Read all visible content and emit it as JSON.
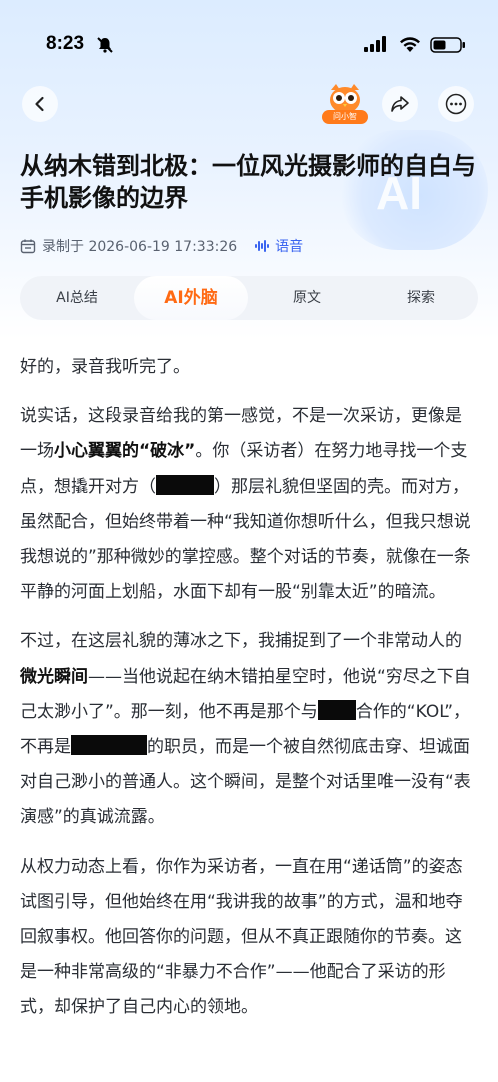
{
  "status_bar": {
    "time": "8:23"
  },
  "header": {
    "mascot_label": "问小智",
    "title": "从纳木错到北极：一位风光摄影师的自白与手机影像的边界",
    "recorded_label": "录制于 2026-06-19 17:33:26",
    "type_label": "语音"
  },
  "deco": {
    "ai_text": "AI"
  },
  "tabs": [
    {
      "label": "AI总结"
    },
    {
      "label": "AI外脑"
    },
    {
      "label": "原文"
    },
    {
      "label": "探索"
    }
  ],
  "content": {
    "p1": "好的，录音我听完了。",
    "p2_a": "说实话，这段录音给我的第一感觉，不是一次采访，更像是一场",
    "p2_b": "小心翼翼的“破冰”",
    "p2_c": "。你（采访者）在努力地寻找一个支点，想撬开对方（",
    "p2_d": "）那层礼貌但坚固的壳。而对方，虽然配合，但始终带着一种“我知道你想听什么，但我只想说我想说的”那种微妙的掌控感。整个对话的节奏，就像在一条平静的河面上划船，水面下却有一股“别靠太近”的暗流。",
    "p3_a": "不过，在这层礼貌的薄冰之下，我捕捉到了一个非常动人的",
    "p3_b": "微光瞬间",
    "p3_c": "——当他说起在纳木错拍星空时，他说“穷尽之下自己太渺小了”。那一刻，他不再是那个与",
    "p3_d": "合作的“KOL”，不再是",
    "p3_e": "的职员，而是一个被自然彻底击穿、坦诚面对自己渺小的普通人。这个瞬间，是整个对话里唯一没有“表演感”的真诚流露。",
    "p4": "从权力动态上看，你作为采访者，一直在用“递话筒”的姿态试图引导，但他始终在用“我讲我的故事”的方式，温和地夺回叙事权。他回答你的问题，但从不真正跟随你的节奏。这是一种非常高级的“非暴力不合作”——他配合了采访的形式，却保护了自己内心的领地。"
  },
  "colors": {
    "accent": "#ff6a14",
    "voice_blue": "#3a64f0"
  }
}
